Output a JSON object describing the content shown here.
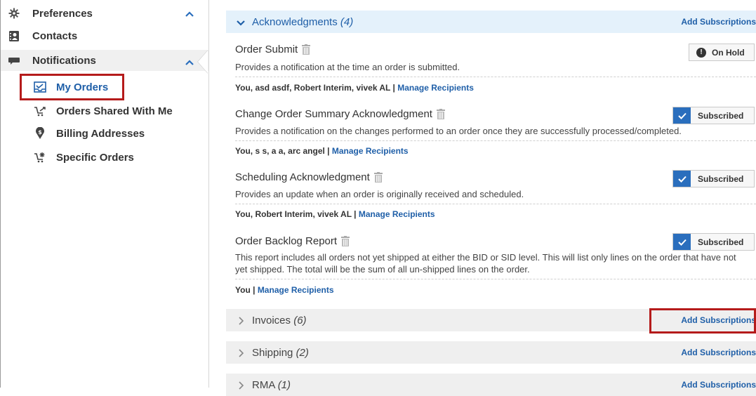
{
  "sidebar": {
    "top_items": [
      {
        "label": "Preferences",
        "icon": "gear-icon"
      },
      {
        "label": "Contacts",
        "icon": "contact-card-icon"
      },
      {
        "label": "Notifications",
        "icon": "comment-icon"
      }
    ],
    "sub_items": [
      {
        "label": "My Orders",
        "icon": "inbox-order-icon"
      },
      {
        "label": "Orders Shared With Me",
        "icon": "cart-share-icon"
      },
      {
        "label": "Billing Addresses",
        "icon": "location-dollar-icon"
      },
      {
        "label": "Specific Orders",
        "icon": "cart-star-icon"
      }
    ]
  },
  "sections": {
    "acknowledgments": {
      "label": "Acknowledgments",
      "count": "(4)",
      "add": "Add Subscriptions"
    },
    "invoices": {
      "label": "Invoices",
      "count": "(6)",
      "add": "Add Subscriptions"
    },
    "shipping": {
      "label": "Shipping",
      "count": "(2)",
      "add": "Add Subscriptions"
    },
    "rma": {
      "label": "RMA",
      "count": "(1)",
      "add": "Add Subscriptions"
    }
  },
  "notifications": [
    {
      "title": "Order Submit",
      "description": "Provides a notification at the time an order is submitted.",
      "recipients": "You, asd asdf, Robert Interim, vivek AL",
      "manage": "Manage Recipients",
      "status": "On Hold"
    },
    {
      "title": "Change Order Summary Acknowledgment",
      "description": "Provides a notification on the changes performed to an order once they are successfully processed/completed.",
      "recipients": "You, s s, a a, arc angel",
      "manage": "Manage Recipients",
      "status": "Subscribed"
    },
    {
      "title": "Scheduling Acknowledgment",
      "description": "Provides an update when an order is originally received and scheduled.",
      "recipients": "You, Robert Interim, vivek AL",
      "manage": "Manage Recipients",
      "status": "Subscribed"
    },
    {
      "title": "Order Backlog Report",
      "description": "This report includes all orders not yet shipped at either the BID or SID level. This will list only lines on the order that have not yet shipped. The total will be the sum of all un-shipped lines on the order.",
      "recipients": "You",
      "manage": "Manage Recipients",
      "status": "Subscribed"
    }
  ],
  "separator": " | ",
  "colors": {
    "accent": "#1f5fa8",
    "highlight": "#b51b1b",
    "subscribed": "#2a6ebd"
  }
}
